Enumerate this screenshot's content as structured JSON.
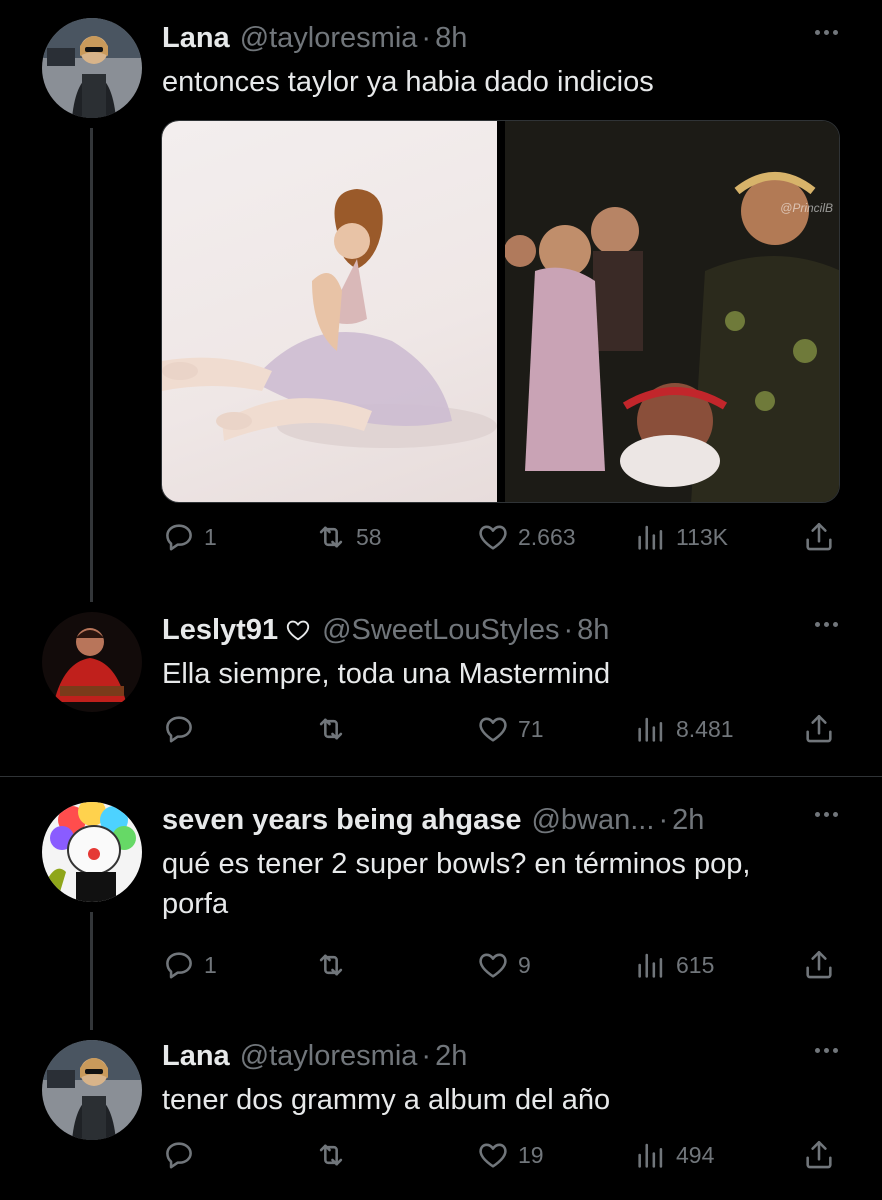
{
  "tweets": [
    {
      "name": "Lana",
      "handle": "@tayloresmia",
      "dot": "·",
      "time": "8h",
      "text": "entonces taylor ya habia dado indicios",
      "media_watermark": "@PrincilB",
      "replies": "1",
      "retweets": "58",
      "likes": "2.663",
      "views": "113K"
    },
    {
      "name": "Leslyt91",
      "handle": "@SweetLouStyles",
      "dot": "·",
      "time": "8h",
      "text": "Ella siempre, toda una Mastermind",
      "replies": "",
      "retweets": "",
      "likes": "71",
      "views": "8.481"
    },
    {
      "name": "seven years being ahgase",
      "handle": "@bwan...",
      "dot": "·",
      "time": "2h",
      "text": "qué es tener 2 super bowls? en términos pop, porfa",
      "replies": "1",
      "retweets": "",
      "likes": "9",
      "views": "615"
    },
    {
      "name": "Lana",
      "handle": "@tayloresmia",
      "dot": "·",
      "time": "2h",
      "text": "tener dos grammy a album del año",
      "replies": "",
      "retweets": "",
      "likes": "19",
      "views": "494"
    }
  ],
  "icons": {
    "reply": "reply-icon",
    "retweet": "retweet-icon",
    "like": "heart-icon",
    "views": "views-icon",
    "share": "share-icon",
    "more": "more-icon"
  },
  "colors": {
    "background": "#000000",
    "text": "#e7e9ea",
    "muted": "#71767b",
    "divider": "#2f3336"
  }
}
